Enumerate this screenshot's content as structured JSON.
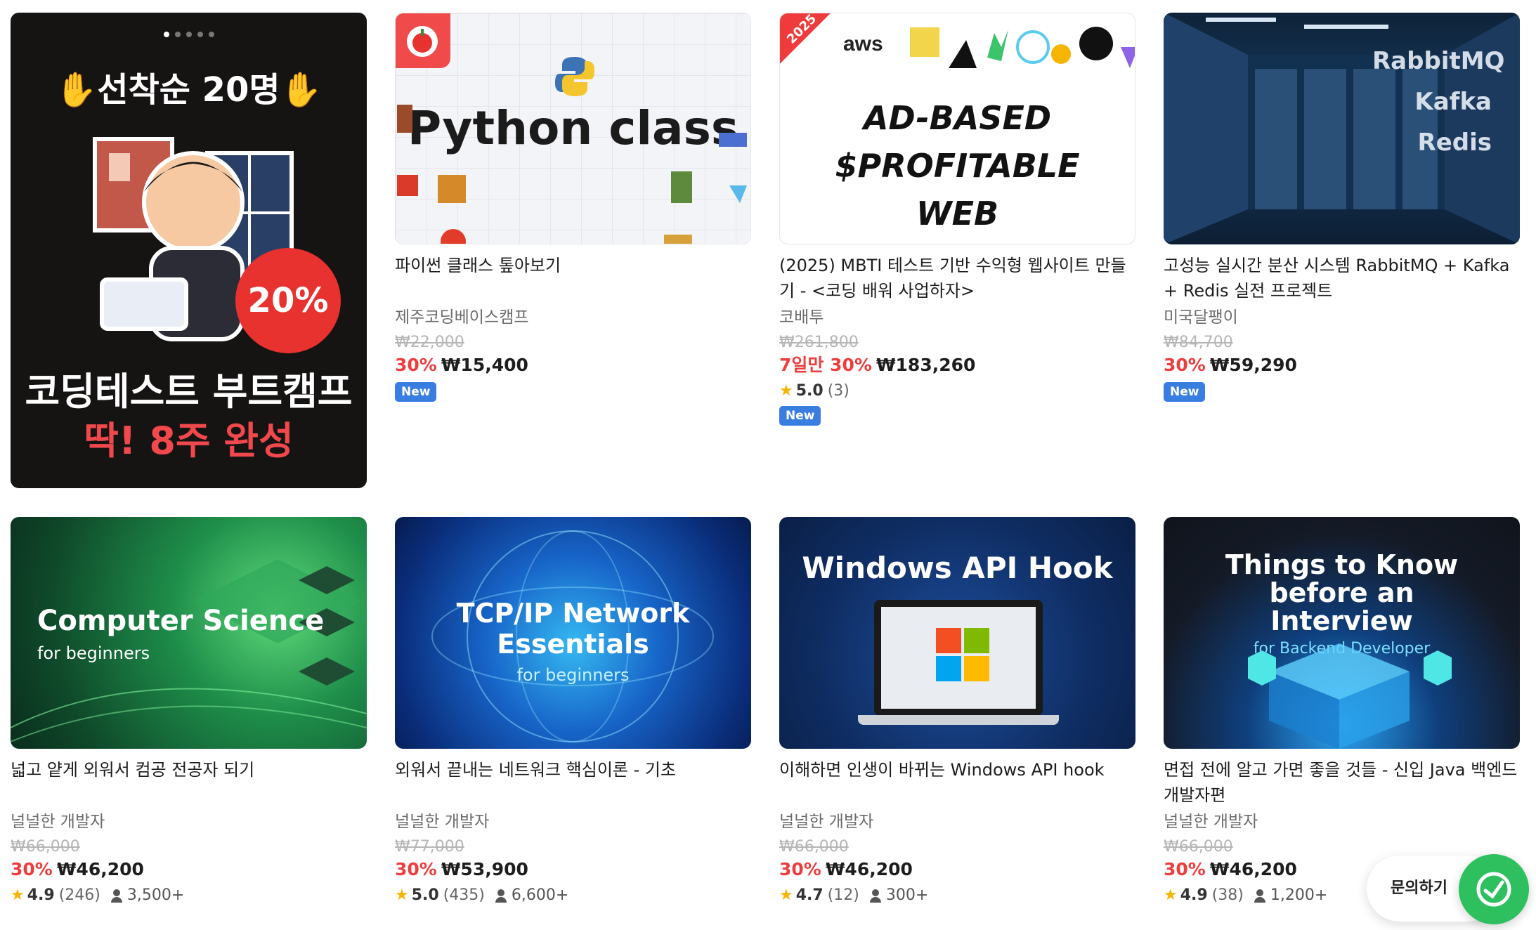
{
  "courses": [
    {
      "promo": true,
      "thumb_top": "✋선착순 20명✋",
      "thumb_pct": "20%",
      "thumb_b1": "코딩테스트 부트캠프",
      "thumb_b2": "딱! 8주 완성"
    },
    {
      "thumb_text": "Python class",
      "title": "파이썬 클래스 톺아보기",
      "instructor": "제주코딩베이스캠프",
      "original_price": "₩22,000",
      "discount": "30%",
      "price": "₩15,400",
      "badge": "New"
    },
    {
      "thumb_ribbon": "2025",
      "thumb_text": "AD-BASED $PROFITABLE WEB",
      "title": "(2025) MBTI 테스트 기반 수익형 웹사이트 만들기 - <코딩 배워 사업하자>",
      "instructor": "코배투",
      "original_price": "₩261,800",
      "discount": "7일만 30%",
      "price": "₩183,260",
      "rating": "5.0",
      "reviews": "(3)",
      "badge": "New"
    },
    {
      "thumb_text": "RabbitMQ Kafka Redis",
      "title": "고성능 실시간 분산 시스템 RabbitMQ + Kafka + Redis 실전 프로젝트",
      "instructor": "미국달팽이",
      "original_price": "₩84,700",
      "discount": "30%",
      "price": "₩59,290",
      "badge": "New"
    },
    {
      "thumb_text": "Computer Science",
      "thumb_sub": "for beginners",
      "title": "넓고 얕게 외워서 컴공 전공자 되기",
      "instructor": "널널한 개발자",
      "original_price": "₩66,000",
      "discount": "30%",
      "price": "₩46,200",
      "rating": "4.9",
      "reviews": "(246)",
      "students": "3,500+"
    },
    {
      "thumb_text": "TCP/IP Network Essentials",
      "thumb_sub": "for beginners",
      "title": "외워서 끝내는 네트워크 핵심이론 - 기초",
      "instructor": "널널한 개발자",
      "original_price": "₩77,000",
      "discount": "30%",
      "price": "₩53,900",
      "rating": "5.0",
      "reviews": "(435)",
      "students": "6,600+"
    },
    {
      "thumb_text": "Windows API Hook",
      "title": "이해하면 인생이 바뀌는 Windows API hook",
      "instructor": "널널한 개발자",
      "original_price": "₩66,000",
      "discount": "30%",
      "price": "₩46,200",
      "rating": "4.7",
      "reviews": "(12)",
      "students": "300+"
    },
    {
      "thumb_text": "Things to Know before an Interview",
      "thumb_sub": "for Backend Developer",
      "title": "면접 전에 알고 가면 좋을 것들 - 신입 Java 백엔드 개발자편",
      "instructor": "널널한 개발자",
      "original_price": "₩66,000",
      "discount": "30%",
      "price": "₩46,200",
      "rating": "4.9",
      "reviews": "(38)",
      "students": "1,200+"
    }
  ],
  "chat": {
    "label": "문의하기"
  },
  "colors": {
    "discount": "#ee3d3d",
    "badge_new": "#3a7de0",
    "chat": "#2ec05f",
    "star": "#f7b500"
  }
}
